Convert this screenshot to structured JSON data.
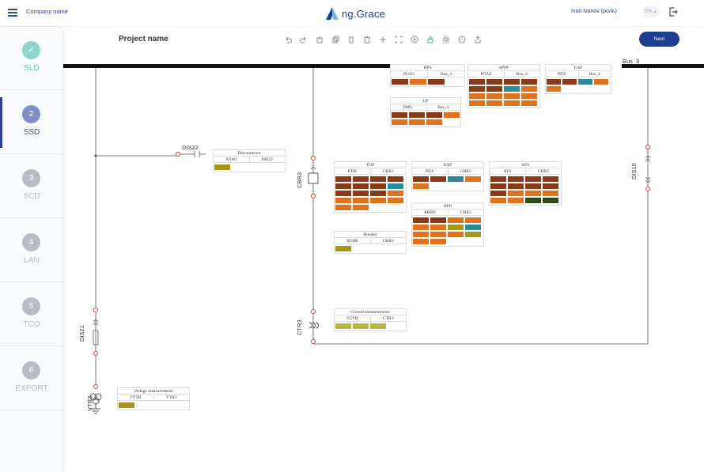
{
  "header": {
    "company": "Company name",
    "app_name": "ng.Grace",
    "user": "Ivan Ivanov (роль)",
    "lang": "EN"
  },
  "steps": [
    {
      "num": "✓",
      "label": "SLD",
      "state": "done"
    },
    {
      "num": "2",
      "label": "SSD",
      "state": "active"
    },
    {
      "num": "3",
      "label": "SCD",
      "state": ""
    },
    {
      "num": "4",
      "label": "LAN",
      "state": ""
    },
    {
      "num": "5",
      "label": "TCO",
      "state": ""
    },
    {
      "num": "6",
      "label": "EXPORT",
      "state": ""
    }
  ],
  "toolbar": {
    "project": "Project name",
    "next": "Next",
    "tools": [
      "undo-icon",
      "redo-icon",
      "export-icon",
      "copy-icon",
      "delete-icon",
      "paste-icon",
      "move-icon",
      "fit-icon",
      "play-icon",
      "lock-icon",
      "settings-icon",
      "help-icon",
      "share-icon"
    ]
  },
  "diagram": {
    "bus_label": "Bus_3",
    "dis22": "DIS22",
    "cbr3": "CBR3",
    "ctr3": "CTR3",
    "dis19": "DIS19",
    "dis21": "DIS21",
    "vtr3": "VTR3"
  },
  "colors": {
    "brown": "#8a3a16",
    "orange": "#e0721c",
    "teal": "#2d8a99",
    "olive": "#a6961a",
    "yellowgreen": "#b7b83a",
    "darkgreen": "#2f4a16",
    "red_node": "#e03b3b"
  },
  "nodes": [
    {
      "id": "bps",
      "title": "BPS",
      "cols": [
        "PLOG",
        "Bus_4"
      ],
      "cells": [
        "brown",
        "orange",
        "brown"
      ]
    },
    {
      "id": "up",
      "title": "UP",
      "cols": [
        "PMU",
        "Bus_4"
      ],
      "cells": [
        "brown",
        "brown",
        "brown",
        "orange",
        "orange",
        "orange",
        "orange"
      ]
    },
    {
      "id": "spfp",
      "title": "SPFP",
      "cols": [
        "POZZ",
        "Bus_4"
      ],
      "cells": [
        "brown",
        "brown",
        "brown",
        "brown",
        "brown",
        "brown",
        "teal",
        "orange",
        "orange",
        "orange",
        "orange",
        "orange",
        "orange",
        "orange",
        "orange",
        "orange"
      ]
    },
    {
      "id": "eap1",
      "title": "EAP",
      "cols": [
        "PDZ",
        "Bus_4"
      ],
      "cells": [
        "brown",
        "brown",
        "teal",
        "orange",
        "orange"
      ]
    },
    {
      "id": "disconnector",
      "title": "Disconnector",
      "cols": [
        "XSWI",
        "DIS22"
      ],
      "cells": [
        "olive"
      ]
    },
    {
      "id": "top",
      "title": "TOP",
      "cols": [
        "PTM",
        "CBR3"
      ],
      "cells": [
        "brown",
        "brown",
        "brown",
        "brown",
        "brown",
        "brown",
        "brown",
        "teal",
        "brown",
        "brown",
        "brown",
        "orange",
        "orange",
        "orange",
        "orange",
        "orange",
        "orange",
        "orange"
      ]
    },
    {
      "id": "eap2",
      "title": "EAP",
      "cols": [
        "PDZ",
        "CBR3"
      ],
      "cells": [
        "brown",
        "brown",
        "teal",
        "orange",
        "orange"
      ]
    },
    {
      "id": "ats",
      "title": "ATS",
      "cols": [
        "ATS",
        "CBR3"
      ],
      "cells": [
        "brown",
        "brown",
        "brown",
        "brown",
        "brown",
        "brown",
        "brown",
        "brown",
        "brown",
        "orange",
        "orange",
        "orange",
        "orange",
        "orange",
        "darkgreen",
        "darkgreen"
      ]
    },
    {
      "id": "bfp",
      "title": "BFP",
      "cols": [
        "RBRF",
        "CBR3"
      ],
      "cells": [
        "brown",
        "brown",
        "orange",
        "orange",
        "orange",
        "orange",
        "olive",
        "teal",
        "orange",
        "orange",
        "orange",
        "olive",
        "orange",
        "orange"
      ]
    },
    {
      "id": "breaker",
      "title": "Breaker",
      "cols": [
        "XCBR",
        "CBR3"
      ],
      "cells": [
        "olive"
      ]
    },
    {
      "id": "current",
      "title": "Current measurements",
      "cols": [
        "TCTR",
        "CTR3"
      ],
      "cells": [
        "yellowgreen",
        "yellowgreen",
        "yellowgreen"
      ]
    },
    {
      "id": "voltage",
      "title": "Voltage measurements",
      "cols": [
        "TVTR",
        "VTR3"
      ],
      "cells": [
        "olive"
      ]
    }
  ]
}
